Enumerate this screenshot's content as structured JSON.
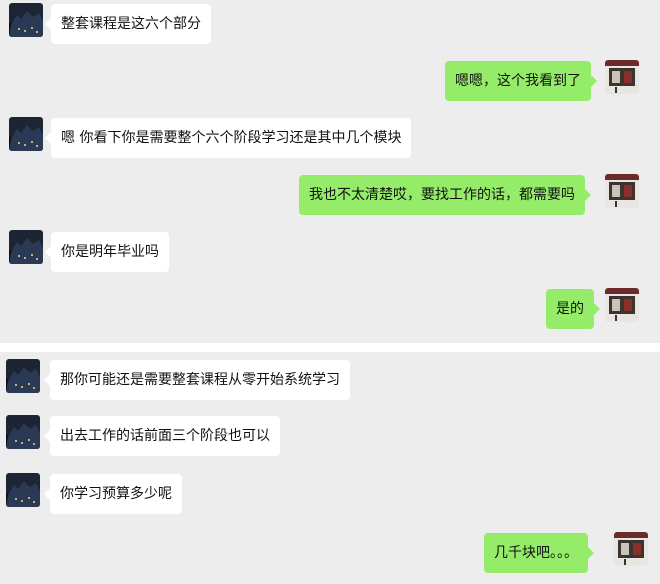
{
  "messages": [
    {
      "side": "in",
      "text": "整套课程是这六个部分",
      "avatar": "city-night-avatar"
    },
    {
      "side": "out",
      "text": "嗯嗯，这个我看到了",
      "avatar": "shop-front-avatar"
    },
    {
      "side": "in",
      "text": "嗯 你看下你是需要整个六个阶段学习还是其中几个模块",
      "avatar": "city-night-avatar"
    },
    {
      "side": "out",
      "text": "我也不太清楚哎，要找工作的话，都需要吗",
      "avatar": "shop-front-avatar"
    },
    {
      "side": "in",
      "text": "你是明年毕业吗",
      "avatar": "city-night-avatar"
    },
    {
      "side": "out",
      "text": "是的",
      "avatar": "shop-front-avatar"
    },
    {
      "side": "in",
      "text": "那你可能还是需要整套课程从零开始系统学习",
      "avatar": "city-night-avatar"
    },
    {
      "side": "in",
      "text": "出去工作的话前面三个阶段也可以",
      "avatar": "city-night-avatar"
    },
    {
      "side": "in",
      "text": "你学习预算多少呢",
      "avatar": "city-night-avatar"
    },
    {
      "side": "out",
      "text": "几千块吧。。。",
      "avatar": "shop-front-avatar"
    }
  ],
  "colors": {
    "background": "#ededed",
    "incoming_bubble": "#ffffff",
    "outgoing_bubble": "#95ec69"
  }
}
